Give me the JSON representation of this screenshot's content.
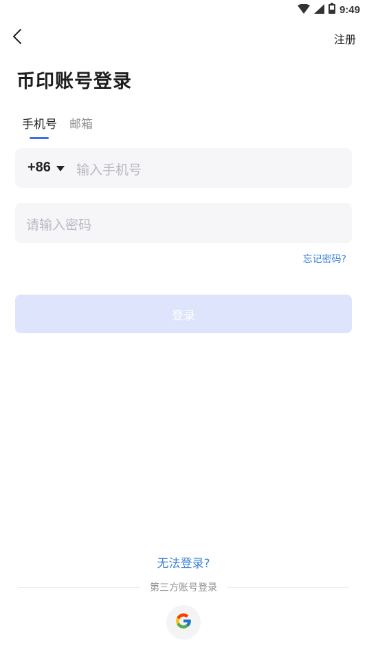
{
  "status_bar": {
    "time": "9:49",
    "icons": [
      "wifi-icon",
      "signal-icon",
      "battery-icon"
    ]
  },
  "header": {
    "back_icon": "chevron-left-icon",
    "register_label": "注册"
  },
  "title": "币印账号登录",
  "tabs": [
    {
      "label": "手机号",
      "active": true
    },
    {
      "label": "邮箱",
      "active": false
    }
  ],
  "phone_field": {
    "country_code": "+86",
    "dropdown_icon": "triangle-down-icon",
    "placeholder": "输入手机号"
  },
  "password_field": {
    "placeholder": "请输入密码"
  },
  "forgot_password": "忘记密码?",
  "login_button": "登录",
  "cannot_login": "无法登录?",
  "third_party": {
    "label": "第三方账号登录",
    "providers": [
      {
        "name": "Google",
        "icon": "google-icon"
      }
    ]
  },
  "colors": {
    "accent": "#3b6fe8",
    "link": "#3b82d8",
    "login_button_disabled": "#dde4fb",
    "field_background": "#f6f6f9",
    "placeholder": "#b8b8c2"
  }
}
